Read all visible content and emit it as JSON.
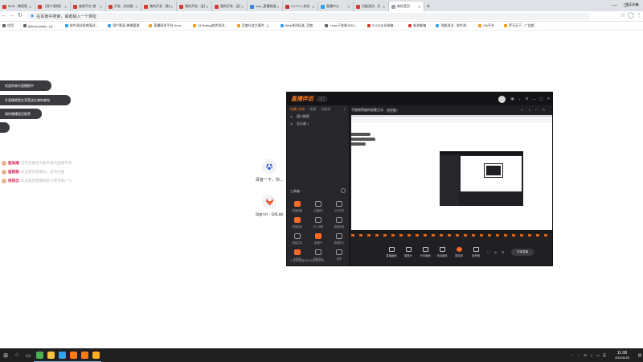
{
  "browser": {
    "tabs": [
      {
        "title": "NHK - 教您您",
        "color": "#d23f31"
      },
      {
        "title": "【苏宁易购】",
        "color": "#d23f31"
      },
      {
        "title": "查理平台·首",
        "color": "#d23f31"
      },
      {
        "title": "开发 - 测试服",
        "color": "#d23f31"
      },
      {
        "title": "我的开发 - 我们",
        "color": "#d23f31"
      },
      {
        "title": "我的开发 - 运行",
        "color": "#d23f31"
      },
      {
        "title": "我的开发 - 运行",
        "color": "#d23f31"
      },
      {
        "title": "cctv_直播频道",
        "color": "#3b82d6"
      },
      {
        "title": "CCTV-1 综合",
        "color": "#c0392b"
      },
      {
        "title": "直播中心",
        "color": "#2ea3f2"
      },
      {
        "title": "功能测试 - 乐",
        "color": "#d23f31"
      },
      {
        "title": "新标签页",
        "color": "#9aa0a6",
        "active": true
      }
    ],
    "new_tab_label": "+",
    "window_controls": {
      "minimize": "—",
      "maximize": "▢",
      "close": "✕"
    },
    "nav": {
      "back": "←",
      "forward": "→",
      "reload": "↻"
    },
    "address_placeholder": "在百度中搜索，或者输入一个网址",
    "bookmarks": [
      {
        "label": "应用",
        "color": "#5f6368"
      },
      {
        "label": "jQuery.post() - jQ...",
        "color": "#5f6368"
      },
      {
        "label": "软件测试经典面试...",
        "color": "#2ea3f2"
      },
      {
        "label": "用户登录-禅道管理",
        "color": "#2ea3f2"
      },
      {
        "label": "直播网关平台 Hom...",
        "color": "#f59c1a"
      },
      {
        "label": "51Testing软件测试...",
        "color": "#f59c1a"
      },
      {
        "label": "百度社会大事件 - [...",
        "color": "#f59c1a"
      },
      {
        "label": "Web测试标准_百度...",
        "color": "#2ea3f2"
      },
      {
        "label": "Linux下安装JDK1...",
        "color": "#5f6368"
      },
      {
        "label": "21CN企业邮箱 - ...",
        "color": "#d23f31"
      },
      {
        "label": "新浪邮箱",
        "color": "#d23f31"
      },
      {
        "label": "功能测试 - 软件测...",
        "color": "#2ea3f2"
      },
      {
        "label": "OA平台",
        "color": "#f59c1a"
      },
      {
        "label": "萨马天下 - 广告超...",
        "color": "#f59c1a"
      }
    ],
    "reading_list": "阅读清单"
  },
  "live_overlay": {
    "pills": [
      "欢迎你来乐园播报中",
      "开直播就是在享受送礼物的感觉",
      "请你播播首页推荐",
      ""
    ],
    "chat": [
      {
        "nick": "狐兔播:",
        "msg": "支持主播给大家带来的直播节目"
      },
      {
        "nick": "狐狸狸:",
        "msg": "欢迎来到直播间，支持主播"
      },
      {
        "nick": "探探怎:",
        "msg": "欢迎来到直播间给大家带来(^-^)"
      }
    ]
  },
  "shortcuts": [
    {
      "label": "百度一下，你...",
      "icon": "baidu-paw-icon"
    },
    {
      "label": "Sign in · GitLab",
      "icon": "gitlab-icon"
    }
  ],
  "stream_app": {
    "logo": "直播伴侣",
    "version": "v6.0",
    "header_controls": [
      "▣",
      "♪",
      "⚙",
      "—",
      "▢",
      "✕"
    ],
    "tabs": [
      "场景1名称",
      "场景",
      "可放场"
    ],
    "active_tab": 0,
    "scenes": [
      "窗口捕获",
      "显示器 1"
    ],
    "tools_title": "工具箱",
    "tools": [
      {
        "label": "直播弹幕",
        "hot": true
      },
      {
        "label": "主播助手"
      },
      {
        "label": "分享任务"
      },
      {
        "label": "直播连麦",
        "hot": true
      },
      {
        "label": "开心消消"
      },
      {
        "label": "直播设置"
      },
      {
        "label": "屏幕共享"
      },
      {
        "label": "直播PK",
        "hot": true
      },
      {
        "label": "直播排行"
      },
      {
        "label": "小程序",
        "hot": true
      },
      {
        "label": "游戏中心"
      },
      {
        "label": "更多"
      }
    ],
    "footer_note": "小视频直播间优化使用说明",
    "stream_title": "不限制等级的观看互动",
    "stream_badge": "未开播",
    "preview_right_icons": [
      "◐",
      "◑",
      "⚐",
      "✎"
    ],
    "bottom_buttons": [
      {
        "label": "直播画面",
        "mic": false
      },
      {
        "label": "摄像头",
        "mic": false
      },
      {
        "label": "分享画面",
        "mic": false
      },
      {
        "label": "添加媒体",
        "mic": false
      },
      {
        "label": "麦克风",
        "mic": true
      },
      {
        "label": "扬声器",
        "mic": false
      }
    ],
    "bottom_small_icons": [
      "⛶",
      "◎",
      "⚙"
    ],
    "start_live_label": "开始直播"
  },
  "taskbar": {
    "start": "⊞",
    "search": "○",
    "taskview": "▭",
    "apps": [
      {
        "name": "chrome",
        "color": "#4caf50"
      },
      {
        "name": "folder",
        "color": "#f6c343"
      },
      {
        "name": "store",
        "color": "#2ea3f2"
      },
      {
        "name": "stream-1",
        "color": "#ff7a1a"
      },
      {
        "name": "stream-2",
        "color": "#ff7a1a"
      },
      {
        "name": "stream-3",
        "color": "#ffb020"
      }
    ],
    "tray_icons": [
      "^",
      "◌",
      "✉",
      "♫",
      "▭",
      "英"
    ],
    "time": "11:08",
    "date": "2021/6/29",
    "notification": "▤"
  }
}
